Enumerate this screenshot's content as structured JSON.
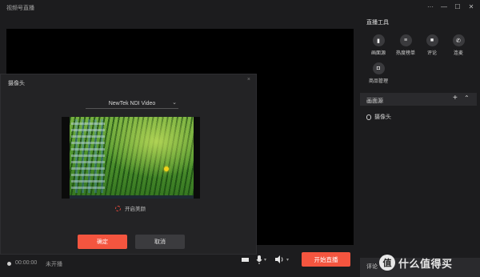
{
  "app": {
    "title": "视频号直播"
  },
  "window_controls": {
    "more": "···",
    "minimize": "—",
    "maximize": "☐",
    "close": "✕"
  },
  "bottom_bar": {
    "timer": "00:00:00",
    "status": "未开播",
    "start_label": "开始直播"
  },
  "right_panel": {
    "title": "直播工具",
    "tools": [
      {
        "label": "画面源",
        "icon": "screen-source-icon",
        "glyph": "▮"
      },
      {
        "label": "热度榜单",
        "icon": "list-icon",
        "glyph": "≡"
      },
      {
        "label": "评论",
        "icon": "comment-icon",
        "glyph": "■"
      },
      {
        "label": "连麦",
        "icon": "phone-icon",
        "glyph": "✆"
      },
      {
        "label": "商品管理",
        "icon": "shopping-bag-icon",
        "glyph": "◘"
      }
    ],
    "source_section": {
      "title": "画面源",
      "add": "+",
      "collapse": "⌃"
    },
    "sources": [
      {
        "label": "摄像头"
      }
    ],
    "comment_bar": {
      "label": "评论"
    }
  },
  "dialog": {
    "title": "摄像头",
    "close": "×",
    "device": "NewTek NDI Video",
    "beauty_label": "开启美颜",
    "ok_label": "确定",
    "cancel_label": "取消"
  },
  "watermark": {
    "logo": "值",
    "text": "什么值得买"
  },
  "colors": {
    "accent": "#f4553f",
    "background": "#1c1c1e",
    "panel": "#2a2a2d"
  }
}
